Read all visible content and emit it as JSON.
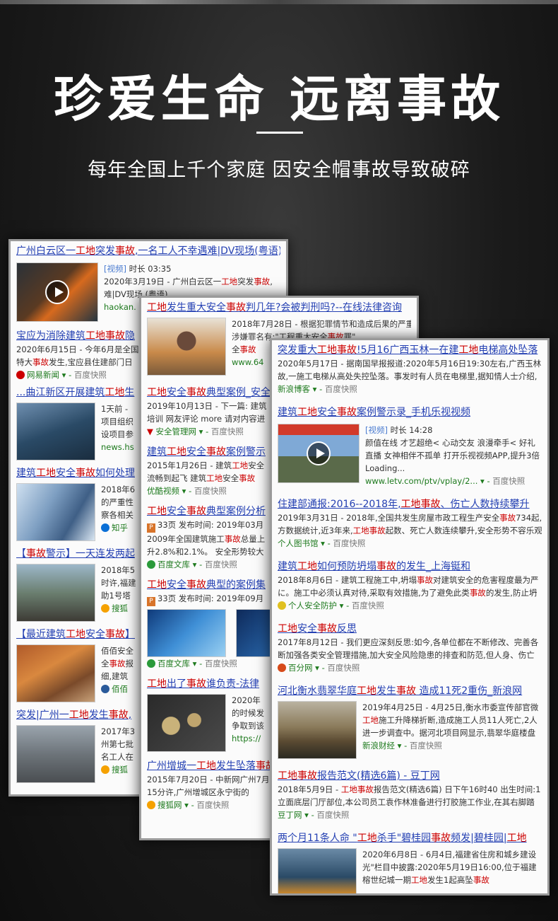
{
  "hero": {
    "title": "珍爱生命 远离事故",
    "subtitle": "每年全国上千个家庭 因安全帽事故导致破碎"
  },
  "card1": [
    {
      "title": "广州白云区一工地突发事故,一名工人不幸遇难|DV现场(粤语)",
      "tag": "[视频]",
      "duration": "时长 03:35",
      "meta": "2020年3月19日 - 广州白云区一工地突发事故,",
      "meta2": "难|DV现场 (粤语)",
      "source": "haokan.",
      "snap": ""
    },
    {
      "title": "宝应为消除建筑工地事故隐",
      "meta": "2020年6月15日 - 今年6月是全国",
      "meta2": "特大事故发生,宝应县住建部门日",
      "source": "网易新闻",
      "snap": "百度快照"
    },
    {
      "title": "...曲江新区开展建筑工地生",
      "meta": "1天前 -",
      "meta2": "项目组织",
      "meta3": "设项目参",
      "source": "news.hs",
      "snap": ""
    },
    {
      "title": "建筑工地安全事故如何处理",
      "meta": "2018年6",
      "meta2": "的严重性",
      "meta3": "察各相关",
      "source": "知乎",
      "snap": ""
    },
    {
      "title": "【事故警示】一天连发两起",
      "meta": "2018年5",
      "meta2": "时许,福建",
      "meta3": "助1号塔",
      "source": "搜狐",
      "snap": ""
    },
    {
      "title": "【最近建筑工地安全事故】",
      "meta": "佰佰安全",
      "meta2": "全事故报",
      "meta3": "细,建筑",
      "source": "佰佰",
      "snap": ""
    },
    {
      "title": "突发|广州一工地发生事故,",
      "meta": "2017年3",
      "meta2": "州第七批",
      "meta3": "名工人在",
      "source": "搜狐",
      "snap": ""
    }
  ],
  "card2": [
    {
      "title": "工地发生重大安全事故判几年?会被判刑吗?--在线法律咨询",
      "meta": "2018年7月28日 - 根据犯罪情节和造成后果的严重程度,",
      "meta2": "涉嫌罪名有:\"工程重大安全事故罪\"",
      "meta3": "全事故",
      "source": "www.64",
      "snap": ""
    },
    {
      "title": "工地安全事故典型案例_安全",
      "meta": "2019年10月13日 - 下一篇: 建筑",
      "meta2": "培训 网友评论 more 请对内容进",
      "source": "安全管理网",
      "snap": "百度快照"
    },
    {
      "title": "建筑工地安全事故案例警示",
      "meta": "2015年1月26日 - 建筑工地安全",
      "meta2": "流畅到起飞 建筑工地安全事故",
      "source": "优酷视频",
      "snap": "百度快照"
    },
    {
      "title": "工地安全事故典型案例分析",
      "meta": "33页 发布时间: 2019年03月",
      "meta2": "2009年全国建筑施工事故总量上",
      "meta3": "升2.8%和2.1%。 安全形势较大",
      "source": "百度文库",
      "snap": "百度快照"
    },
    {
      "title": "工地安全事故典型的案例集",
      "meta": "33页 发布时间: 2019年09月",
      "source": "百度文库",
      "snap": "百度快照"
    },
    {
      "title": "工地出了事故谁负责-法律",
      "meta": "2020年",
      "meta2": "的时候发",
      "meta3": "争取到该",
      "source": "https://",
      "snap": ""
    },
    {
      "title": "广州增城一工地发生坠落事故",
      "meta": "2015年7月20日 - 中新网广州7月",
      "meta2": "15分许,广州增城区永宁街的",
      "source": "搜狐网",
      "snap": "百度快照"
    }
  ],
  "card3": [
    {
      "title": "突发重大工地事故!5月16广西玉林一在建工地电梯高处坠落",
      "meta": "2020年5月17日 - 据南国早报报道:2020年5月16日19:30左右,广西玉林",
      "meta2": "故,一施工电梯从高处失控坠落。事发时有人员在电梯里,据知情人士介绍,",
      "source": "新浪博客",
      "snap": "百度快照"
    },
    {
      "title": "建筑工地安全事故案例警示录_手机乐视视频",
      "tag": "[视频]",
      "duration": "时长 14:28",
      "meta": "颜值在线 才艺超绝< 心动交友 浪漫牵手< 好礼",
      "meta2": "直播 女神相伴不孤单 打开乐视视频APP,提升3倍",
      "meta3": "Loading...",
      "source": "www.letv.com/ptv/vplay/2...",
      "snap": "百度快照"
    },
    {
      "title": "住建部通报:2016--2018年,工地事故、伤亡人数持续攀升",
      "meta": "2019年3月31日 - 2018年,全国共发生房屋市政工程生产安全事故734起,",
      "meta2": "方数据统计,近3年来,工地事故起数、死亡人数连续攀升,安全形势不容乐观",
      "source": "个人图书馆",
      "snap": "百度快照"
    },
    {
      "title": "建筑工地如何预防坍塌事故的发生_上海铤和",
      "meta": "2018年8月6日 - 建筑工程施工中,坍塌事故对建筑安全的危害程度最为严",
      "meta2": "に。施工中必须认真对待,采取有效措施,为了避免此类事故的发生,防止坍",
      "source": "个人安全防护",
      "snap": "百度快照"
    },
    {
      "title": "工地安全事故反思",
      "meta": "2017年8月12日 - 我们更应深刻反思:如今,各单位都在不断修改、完善各",
      "meta2": "断加强各类安全管理措施,加大安全风险隐患的排查和防范,但人身、伤亡",
      "source": "百分网",
      "snap": "百度快照"
    },
    {
      "title": "河北衡水翡翠华庭工地发生事故 造成11死2重伤_新浪网",
      "meta": "2019年4月25日 - 4月25日,衡水市委宣传部官微",
      "meta2": "工地施工升降梯折断,造成施工人员11人死亡,2人",
      "meta3": "进一步调查中。据河北项目网显示,翡翠华庭楼盘",
      "source": "新浪财经",
      "snap": "百度快照"
    },
    {
      "title": "工地事故报告范文(精选6篇) - 豆丁网",
      "meta": "2018年5月9日 - 工地事故报告范文(精选6篇) 日下午16时40 出生时间:1",
      "meta2": "立面底层门厅部位,本公司员工袁作林准备进行打胶施工作业,在其右脚踏",
      "source": "豆丁网",
      "snap": "百度快照"
    },
    {
      "title": "两个月11条人命 \"工地杀手\"碧桂园事故频发|碧桂园|工地",
      "meta": "2020年6月8日 - 6月4日,福建省住房和城乡建设",
      "meta2": "光\"栏目中披露:2020年5月19日16:00,位于福建",
      "meta3": "榕世纪城一期工地发生1起高坠事故",
      "source": "",
      "snap": ""
    }
  ],
  "colors": {
    "link": "#2440b3",
    "keyword": "#cc0000",
    "source": "#1e7a1e",
    "background": "#1b1b1b"
  }
}
